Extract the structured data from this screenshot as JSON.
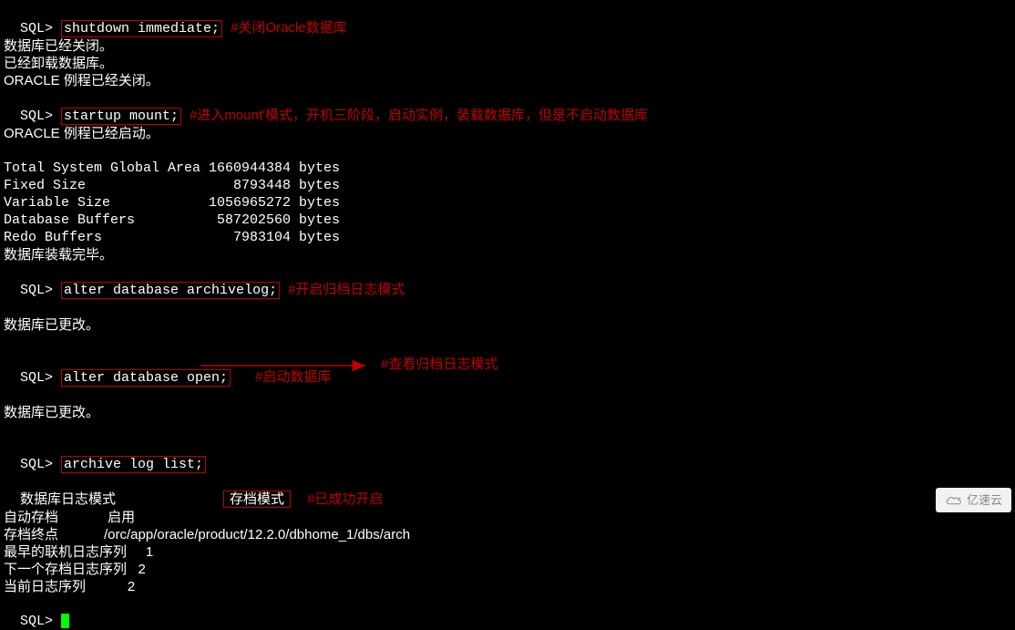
{
  "prompt": "SQL> ",
  "cmd1": "shutdown immediate;",
  "ann1": "#关闭Oracle数据库",
  "out1a": "数据库已经关闭。",
  "out1b": "已经卸载数据库。",
  "out1c": "ORACLE 例程已经关闭。",
  "cmd2": "startup mount;",
  "ann2": "#进入mount'模式，开机三阶段，启动实例，装载数据库，但是不启动数据库",
  "out2a": "ORACLE 例程已经启动。",
  "sga1": "Total System Global Area 1660944384 bytes",
  "sga2": "Fixed Size                  8793448 bytes",
  "sga3": "Variable Size            1056965272 bytes",
  "sga4": "Database Buffers          587202560 bytes",
  "sga5": "Redo Buffers                7983104 bytes",
  "out2b": "数据库装载完毕。",
  "cmd3": "alter database archivelog;",
  "ann3": "#开启归档日志模式",
  "out3": "数据库已更改。",
  "cmd4": "alter database open;",
  "ann4": "#启动数据库",
  "out4": "数据库已更改。",
  "cmd5": "archive log list;",
  "ann5": "#查看归档日志模式",
  "ll1a": "数据库日志模式",
  "ll1b": "存档模式",
  "ann6": "#已成功开启",
  "ll2": "自动存档             启用",
  "ll3": "存档终点            /orc/app/oracle/product/12.2.0/dbhome_1/dbs/arch",
  "ll4": "最早的联机日志序列     1",
  "ll5": "下一个存档日志序列   2",
  "ll6": "当前日志序列           2",
  "watermark": "亿速云"
}
